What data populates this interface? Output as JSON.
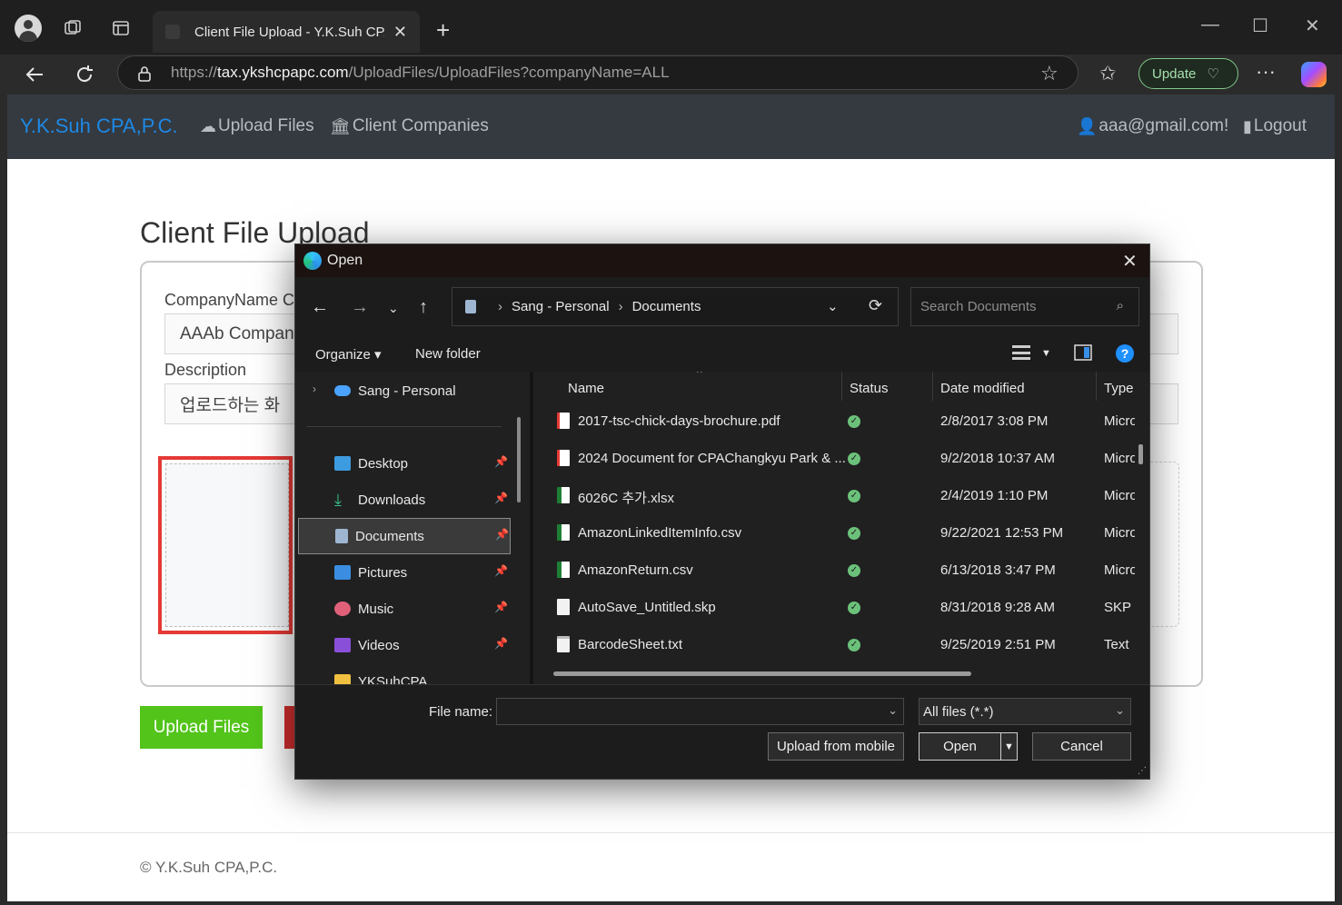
{
  "browser": {
    "tab_title": "Client File Upload - Y.K.Suh CPA,P",
    "url_prefix": "https://",
    "url_host": "tax.ykshcpapc.com",
    "url_path": "/UploadFiles/UploadFiles?companyName=ALL",
    "update_label": "Update"
  },
  "site": {
    "brand": "Y.K.Suh CPA,P.C.",
    "nav": {
      "upload_files": "Upload Files",
      "client_companies": "Client Companies",
      "user": "aaa@gmail.com!",
      "logout": "Logout"
    },
    "page_title": "Client File Upload",
    "company_label": "CompanyName C",
    "company_value": "AAAb Company",
    "description_label": "Description",
    "description_value": "업로드하는 화",
    "upload_button": "Upload Files",
    "footer": "© Y.K.Suh CPA,P.C."
  },
  "dialog": {
    "title": "Open",
    "breadcrumb": [
      "Sang - Personal",
      "Documents"
    ],
    "search_placeholder": "Search Documents",
    "organize": "Organize",
    "new_folder": "New folder",
    "sidebar": {
      "root": "Sang - Personal",
      "items": [
        "Desktop",
        "Downloads",
        "Documents",
        "Pictures",
        "Music",
        "Videos",
        "YKSuhCPA"
      ]
    },
    "columns": {
      "name": "Name",
      "status": "Status",
      "date": "Date modified",
      "type": "Type"
    },
    "files": [
      {
        "name": "2017-tsc-chick-days-brochure.pdf",
        "date": "2/8/2017 3:08 PM",
        "type": "Micro"
      },
      {
        "name": "2024 Document for CPAChangkyu Park & ...",
        "date": "9/2/2018 10:37 AM",
        "type": "Micro"
      },
      {
        "name": "6026C 추가.xlsx",
        "date": "2/4/2019 1:10 PM",
        "type": "Micro"
      },
      {
        "name": "AmazonLinkedItemInfo.csv",
        "date": "9/22/2021 12:53 PM",
        "type": "Micro"
      },
      {
        "name": "AmazonReturn.csv",
        "date": "6/13/2018 3:47 PM",
        "type": "Micro"
      },
      {
        "name": "AutoSave_Untitled.skp",
        "date": "8/31/2018 9:28 AM",
        "type": "SKP I"
      },
      {
        "name": "BarcodeSheet.txt",
        "date": "9/25/2019 2:51 PM",
        "type": "Text"
      }
    ],
    "file_name_label": "File name:",
    "file_name_value": "",
    "filter": "All files (*.*)",
    "upload_mobile": "Upload from mobile",
    "open": "Open",
    "cancel": "Cancel"
  }
}
